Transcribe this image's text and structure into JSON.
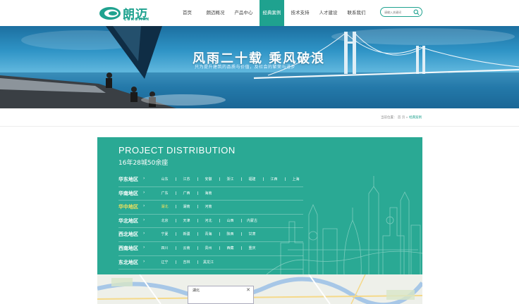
{
  "header": {
    "logo_cn": "朗迈",
    "logo_en": "LONGMAX",
    "nav": [
      "首页",
      "朗迈概况",
      "产品中心",
      "经典案例",
      "技术支持",
      "人才建设",
      "联系我们"
    ],
    "search_placeholder": "请输入关键词"
  },
  "banner": {
    "title": "风雨二十载  乘风破浪",
    "subtitle": "只为提升建筑的品质与价值，及社会的繁荣与进步"
  },
  "breadcrumb": {
    "prefix": "当前位置：",
    "home": "首 页",
    "sep": "»",
    "current": "经典案例"
  },
  "distribution": {
    "title": "PROJECT DISTRIBUTION",
    "subtitle": "16年28城50余座",
    "arrow": "›",
    "regions": [
      {
        "label": "华东地区",
        "provinces": [
          "山东",
          "江苏",
          "安徽",
          "浙江",
          "福建",
          "江西",
          "上海"
        ]
      },
      {
        "label": "华南地区",
        "provinces": [
          "广东",
          "广西",
          "海南"
        ]
      },
      {
        "label": "华中地区",
        "provinces": [
          "湖北",
          "湖南",
          "河南"
        ]
      },
      {
        "label": "华北地区",
        "provinces": [
          "北京",
          "天津",
          "河北",
          "山西",
          "内蒙古"
        ]
      },
      {
        "label": "西北地区",
        "provinces": [
          "宁夏",
          "新疆",
          "青海",
          "陕西",
          "甘肃"
        ]
      },
      {
        "label": "西南地区",
        "provinces": [
          "四川",
          "云南",
          "贵州",
          "西藏",
          "重庆"
        ]
      },
      {
        "label": "东北地区",
        "provinces": [
          "辽宁",
          "吉林",
          "黑龙江"
        ]
      }
    ],
    "active_region": "华中地区",
    "active_province": "湖北"
  },
  "map": {
    "popup_title": "湖北",
    "close": "✕"
  },
  "colors": {
    "brand": "#1fa28f",
    "panel": "#2aa994",
    "highlight": "#f4e25b"
  }
}
